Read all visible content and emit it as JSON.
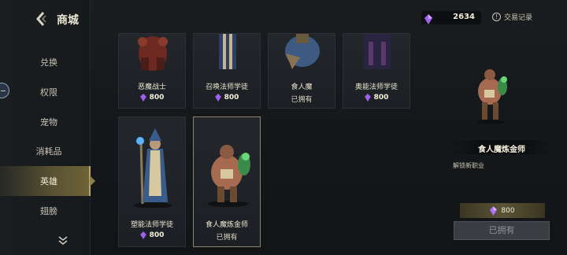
{
  "header": {
    "title": "商城",
    "currency": {
      "amount": "2634",
      "color": "#b070ff"
    },
    "history_label": "交易记录"
  },
  "sidebar": {
    "items": [
      {
        "label": "兑换",
        "active": false
      },
      {
        "label": "权限",
        "active": false
      },
      {
        "label": "宠物",
        "active": false
      },
      {
        "label": "消耗品",
        "active": false
      },
      {
        "label": "英雄",
        "active": true
      },
      {
        "label": "翅膀",
        "active": false
      }
    ]
  },
  "heroes": [
    {
      "name": "恶魔战士",
      "price": "800",
      "owned": false
    },
    {
      "name": "召唤法师学徒",
      "price": "800",
      "owned": false
    },
    {
      "name": "食人魔",
      "owned_label": "已拥有",
      "owned": true
    },
    {
      "name": "奥能法师学徒",
      "price": "800",
      "owned": false
    },
    {
      "name": "塑能法师学徒",
      "price": "800",
      "owned": false
    },
    {
      "name": "食人魔炼金师",
      "owned_label": "已拥有",
      "owned": true,
      "selected": true
    }
  ],
  "detail": {
    "title": "食人魔炼金师",
    "description": "解锁新职业",
    "price": "800",
    "button_label": "已拥有"
  }
}
